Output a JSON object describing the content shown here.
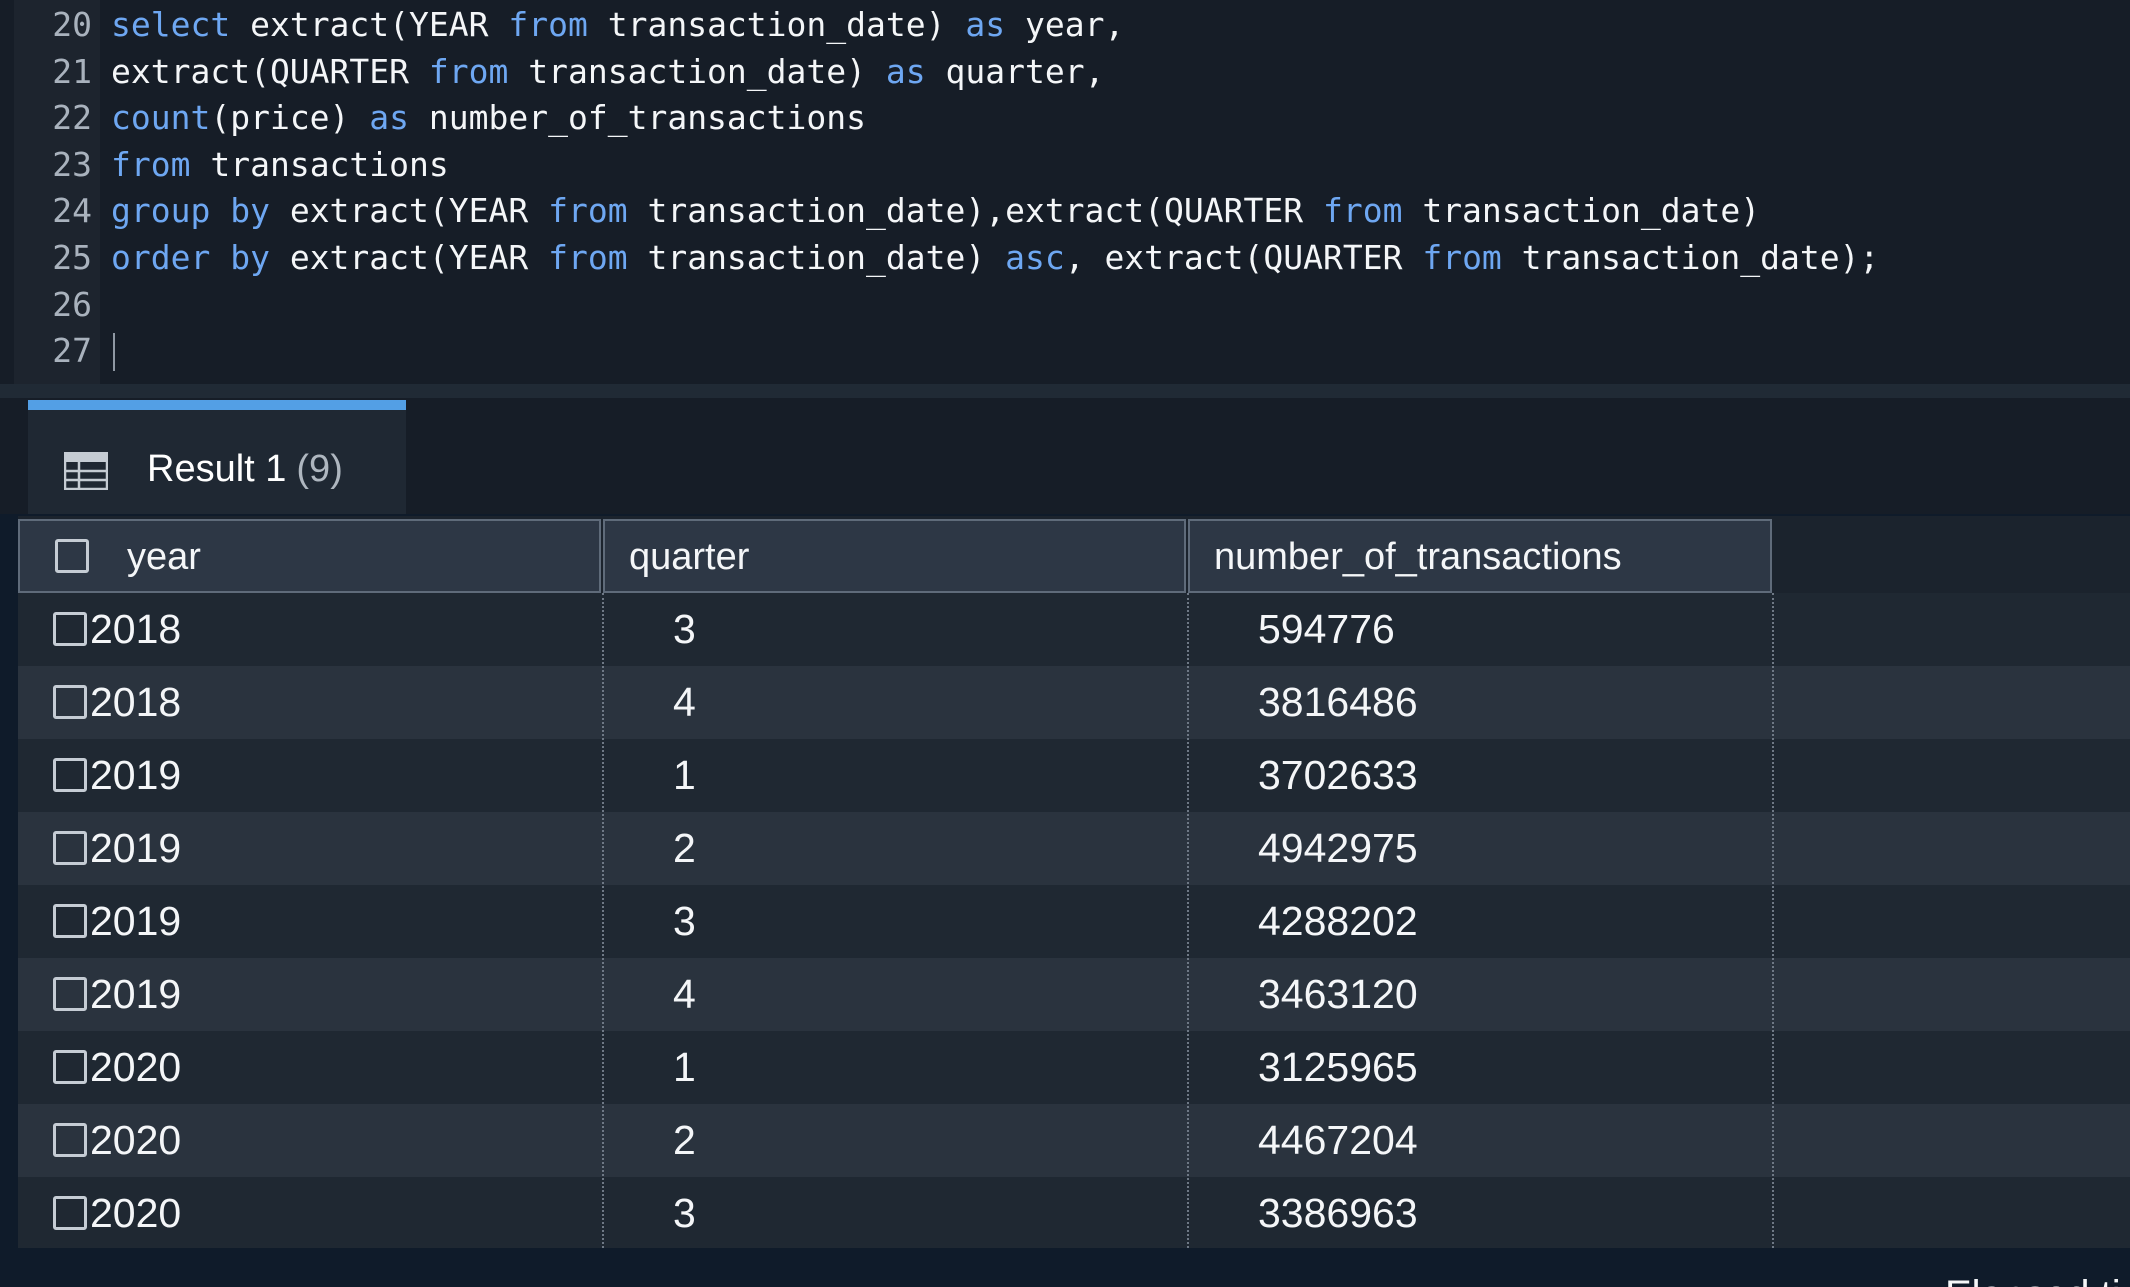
{
  "editor": {
    "lines": [
      {
        "number": "20",
        "tokens": [
          {
            "t": "select",
            "kw": true
          },
          {
            "t": " extract(YEAR "
          },
          {
            "t": "from",
            "kw": true
          },
          {
            "t": " transaction_date) "
          },
          {
            "t": "as",
            "kw": true
          },
          {
            "t": " year,"
          }
        ]
      },
      {
        "number": "21",
        "tokens": [
          {
            "t": "extract(QUARTER "
          },
          {
            "t": "from",
            "kw": true
          },
          {
            "t": " transaction_date) "
          },
          {
            "t": "as",
            "kw": true
          },
          {
            "t": " quarter,"
          }
        ]
      },
      {
        "number": "22",
        "tokens": [
          {
            "t": "count",
            "kw": true
          },
          {
            "t": "(price) "
          },
          {
            "t": "as",
            "kw": true
          },
          {
            "t": " number_of_transactions"
          }
        ]
      },
      {
        "number": "23",
        "tokens": [
          {
            "t": "from",
            "kw": true
          },
          {
            "t": " transactions"
          }
        ]
      },
      {
        "number": "24",
        "tokens": [
          {
            "t": "group by",
            "kw": true
          },
          {
            "t": " extract(YEAR "
          },
          {
            "t": "from",
            "kw": true
          },
          {
            "t": " transaction_date),extract(QUARTER "
          },
          {
            "t": "from",
            "kw": true
          },
          {
            "t": " transaction_date)"
          }
        ]
      },
      {
        "number": "25",
        "tokens": [
          {
            "t": "order by",
            "kw": true
          },
          {
            "t": " extract(YEAR "
          },
          {
            "t": "from",
            "kw": true
          },
          {
            "t": " transaction_date) "
          },
          {
            "t": "asc",
            "kw": true
          },
          {
            "t": ", extract(QUARTER "
          },
          {
            "t": "from",
            "kw": true
          },
          {
            "t": " transaction_date);"
          }
        ]
      },
      {
        "number": "26",
        "tokens": []
      },
      {
        "number": "27",
        "tokens": []
      }
    ]
  },
  "results": {
    "tab_label": "Result 1",
    "tab_count": "(9)",
    "icon": "table-icon",
    "columns": [
      "year",
      "quarter",
      "number_of_transactions"
    ],
    "rows": [
      [
        "2018",
        "3",
        "594776"
      ],
      [
        "2018",
        "4",
        "3816486"
      ],
      [
        "2019",
        "1",
        "3702633"
      ],
      [
        "2019",
        "2",
        "4942975"
      ],
      [
        "2019",
        "3",
        "4288202"
      ],
      [
        "2019",
        "4",
        "3463120"
      ],
      [
        "2020",
        "1",
        "3125965"
      ],
      [
        "2020",
        "2",
        "4467204"
      ],
      [
        "2020",
        "3",
        "3386963"
      ]
    ]
  },
  "footer": {
    "elapsed_partial": "Elapsed ti"
  },
  "colors": {
    "keyword": "#6ea7f2",
    "accent": "#539fe5",
    "background": "#161d27"
  }
}
